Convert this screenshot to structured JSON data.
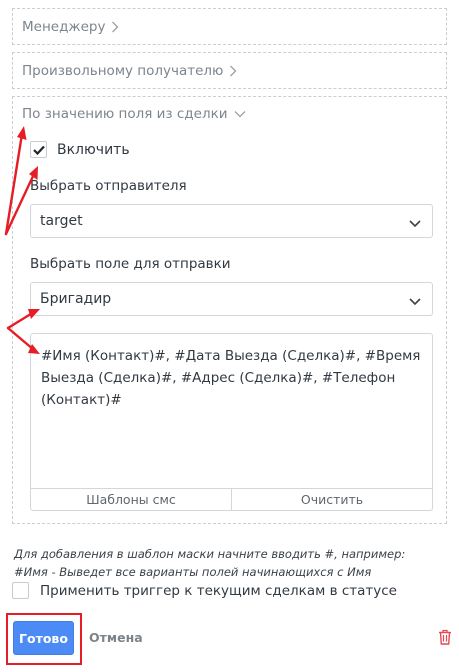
{
  "sections": {
    "manager": {
      "label": "Менеджеру"
    },
    "custom_recipient": {
      "label": "Произвольному получателю"
    },
    "by_field": {
      "label": "По значению поля из сделки"
    }
  },
  "enable": {
    "label": "Включить",
    "checked": true
  },
  "sender": {
    "label": "Выбрать отправителя",
    "value": "target"
  },
  "send_field": {
    "label": "Выбрать поле для отправки",
    "value": "Бригадир"
  },
  "template": {
    "text": "#Имя (Контакт)#, #Дата Выезда (Сделка)#, #Время Выезда (Сделка)#, #Адрес (Сделка)#, #Телефон (Контакт)#",
    "sms_templates_label": "Шаблоны смс",
    "clear_label": "Очистить"
  },
  "hint": {
    "line1": "Для добавления в шаблон маски начните вводить #, например:",
    "line2": "#Имя - Выведет все варианты полей начинающихся с Имя"
  },
  "apply_existing": {
    "label": "Применить триггер к текущим сделкам в статусе",
    "checked": false
  },
  "actions": {
    "done_label": "Готово",
    "cancel_label": "Отмена"
  },
  "colors": {
    "primary": "#4c8bf5",
    "annotation": "#e61d26",
    "delete": "#e8484e"
  }
}
